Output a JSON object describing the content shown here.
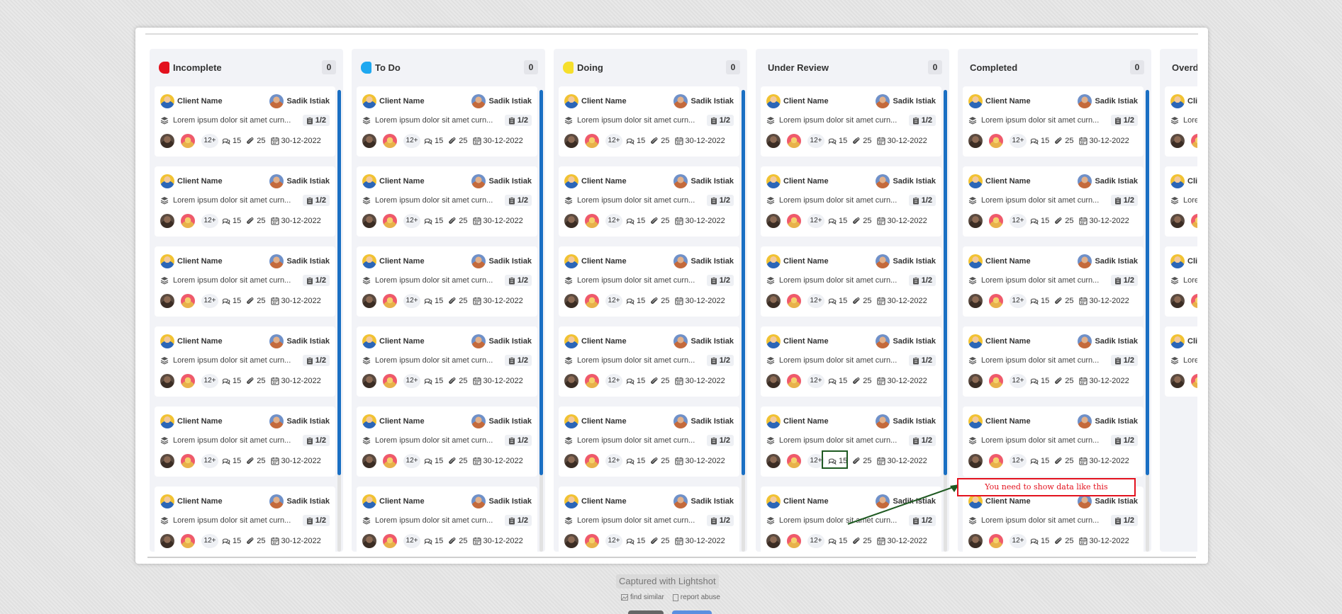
{
  "columns": [
    {
      "title": "Incomplete",
      "count": "0",
      "color": "#e3121e"
    },
    {
      "title": "To Do",
      "count": "0",
      "color": "#1ea8f0"
    },
    {
      "title": "Doing",
      "count": "0",
      "color": "#f6df2c"
    },
    {
      "title": "Under Review",
      "count": "0",
      "color": ""
    },
    {
      "title": "Completed",
      "count": "0",
      "color": ""
    },
    {
      "title": "Overdue",
      "count": "",
      "color": ""
    }
  ],
  "card": {
    "client": "Client Name",
    "assignee": "Sadik Istiak",
    "description": "Lorem ipsum dolor sit amet curn...",
    "progress": "1/2",
    "more": "12+",
    "comments": "15",
    "attachments": "25",
    "date": "30-12-2022"
  },
  "annotation": {
    "text": "You need to show data like this"
  },
  "footer": {
    "captured": "Captured with Lightshot",
    "find_similar": "find similar",
    "report_abuse": "report abuse"
  },
  "colors": {
    "accent": "#1a6fc3",
    "annotation": "#e3121e",
    "annotation_box": "#1f5a22"
  }
}
